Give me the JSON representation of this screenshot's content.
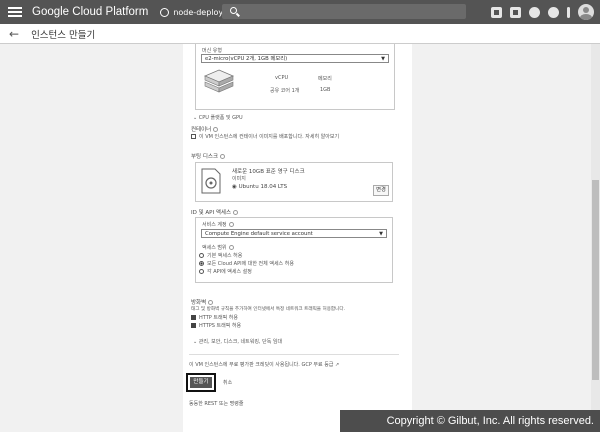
{
  "topbar": {
    "brand": "Google Cloud Platform",
    "project": "node-deploy"
  },
  "page": {
    "title": "인스턴스 만들기"
  },
  "machine": {
    "label": "머신 유형",
    "selected": "e2-micro(vCPU 2개, 1GB 메모리)",
    "vcpu_header": "vCPU",
    "memory_header": "메모리",
    "vcpu_value": "공유 코어 1개",
    "memory_value": "1GB",
    "cpu_platform_link": "CPU 플랫폼 및 GPU"
  },
  "container": {
    "label": "컨테이너",
    "checkbox_text": "이 VM 인스턴스에 컨테이너 이미지를 배포합니다. 자세히 알아보기"
  },
  "boot_disk": {
    "label": "부팅 디스크",
    "description": "새로운 10GB 표준 영구 디스크",
    "image_label": "이미지",
    "image": "Ubuntu 18.04 LTS",
    "change_button": "변경"
  },
  "identity": {
    "label": "ID 및 API 액세스",
    "service_account_label": "서비스 계정",
    "service_account": "Compute Engine default service account",
    "access_scope_label": "액세스 범위",
    "options": [
      "기본 액세스 허용",
      "모든 Cloud API에 대한 전체 액세스 허용",
      "각 API에 액세스 설정"
    ],
    "selected_index": 1
  },
  "firewall": {
    "label": "방화벽",
    "description": "태그 및 방화벽 규칙을 추가하여 인터넷에서 특정 네트워크 트래픽을 허용합니다.",
    "options": [
      "HTTP 트래픽 허용",
      "HTTPS 트래픽 허용"
    ]
  },
  "advanced_link": "관리, 보안, 디스크, 네트워킹, 단독 임대",
  "billing_note": "이 VM 인스턴스에 무료 평가판 크레딧이 사용됩니다. GCP 무료 등급",
  "actions": {
    "create": "만들기",
    "cancel": "취소"
  },
  "rest_link": "동등한 REST 또는 명령줄",
  "watermark": "Copyright © Gilbut, Inc. All rights reserved."
}
